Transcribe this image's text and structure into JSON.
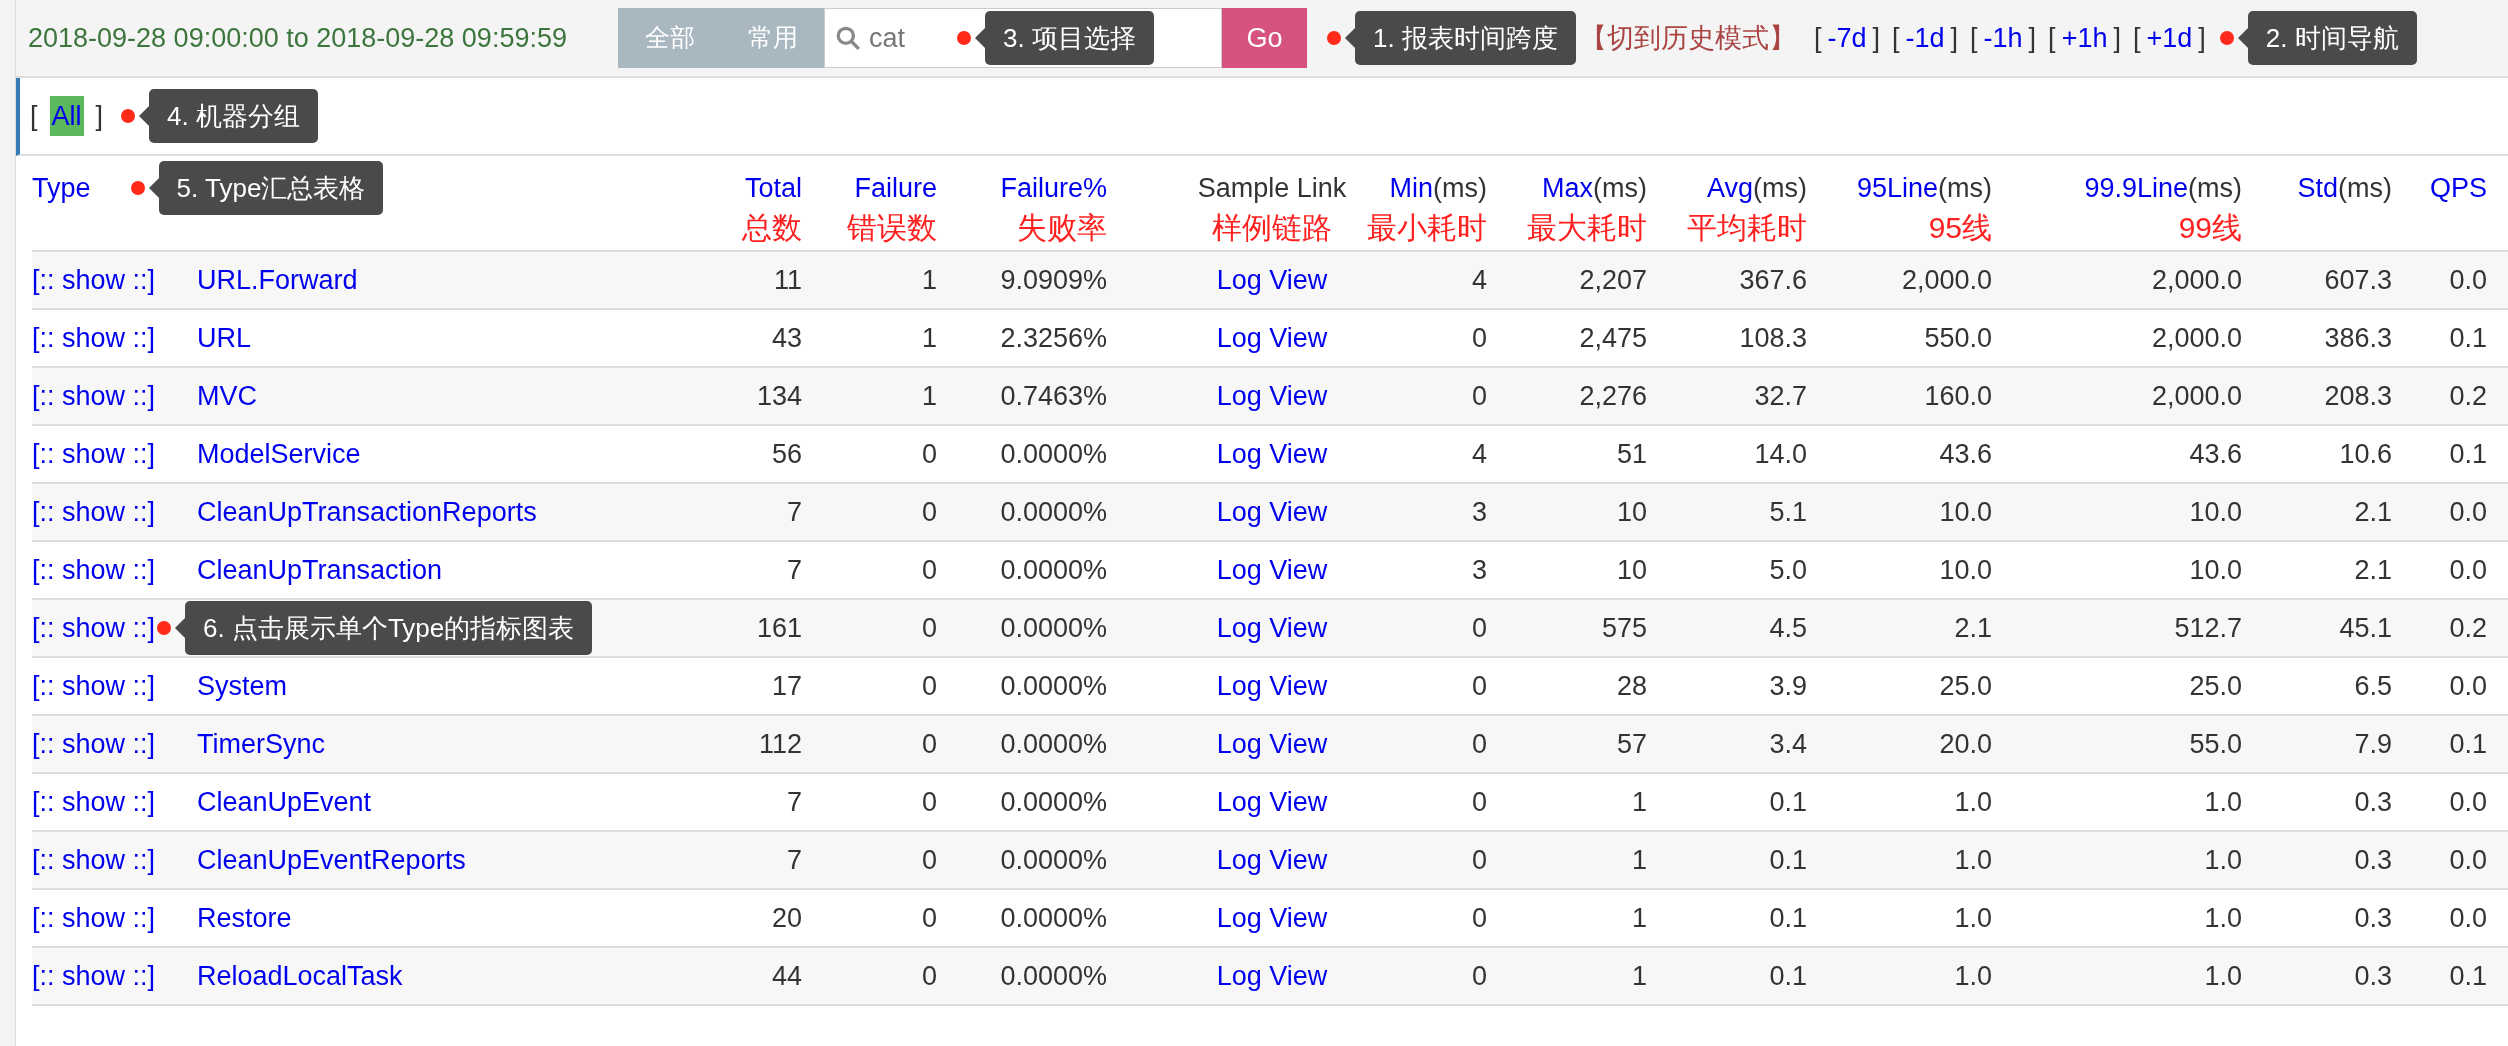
{
  "top_bar": {
    "time_range": "2018-09-28 09:00:00 to 2018-09-28 09:59:59",
    "scope_buttons": [
      {
        "label": "全部"
      },
      {
        "label": "常用"
      }
    ],
    "search": {
      "value": "cat"
    },
    "search_callout": "3. 项目选择",
    "go_button": "Go",
    "time_callout": "1. 报表时间跨度",
    "history_mode": "【切到历史模式】",
    "nav": [
      {
        "open": "[",
        "label": "-7d",
        "close": "]"
      },
      {
        "open": "[",
        "label": "-1d",
        "close": "]"
      },
      {
        "open": "[",
        "label": "-1h",
        "close": "]"
      },
      {
        "open": "[",
        "label": "+1h",
        "close": "]"
      },
      {
        "open": "[",
        "label": "+1d",
        "close": "]"
      }
    ],
    "nav_callout": "2. 时间导航"
  },
  "machine_group": {
    "open": "[",
    "label": "All",
    "close": "]",
    "selected": true,
    "callout": "4. 机器分组"
  },
  "table": {
    "columns": [
      {
        "label": "Type",
        "callout": "5. Type汇总表格",
        "kind": "sortable"
      },
      {
        "kind": "blank"
      },
      {
        "label": "Total",
        "note": "总数",
        "kind": "sortable"
      },
      {
        "label": "Failure",
        "note": "错误数",
        "kind": "sortable"
      },
      {
        "label": "Failure%",
        "note": "失败率",
        "kind": "sortable"
      },
      {
        "label": "Sample Link",
        "note": "样例链路",
        "kind": "plain"
      },
      {
        "label": "Min",
        "unit": "(ms)",
        "note": "最小耗时",
        "kind": "sortable"
      },
      {
        "label": "Max",
        "unit": "(ms)",
        "note": "最大耗时",
        "kind": "sortable"
      },
      {
        "label": "Avg",
        "unit": "(ms)",
        "note": "平均耗时",
        "kind": "sortable"
      },
      {
        "label": "95Line",
        "unit": "(ms)",
        "note": "95线",
        "kind": "sortable"
      },
      {
        "label": "99.9Line",
        "unit": "(ms)",
        "note": "99线",
        "kind": "sortable"
      },
      {
        "label": "Std",
        "unit": "(ms)",
        "kind": "sortable"
      },
      {
        "label": "QPS",
        "kind": "sortable"
      }
    ],
    "rows": [
      {
        "cells": [
          "[:: show ::]",
          "URL.Forward",
          "11",
          "1",
          "9.0909%",
          "Log View",
          "4",
          "2,207",
          "367.6",
          "2,000.0",
          "2,000.0",
          "607.3",
          "0.0"
        ]
      },
      {
        "cells": [
          "[:: show ::]",
          "URL",
          "43",
          "1",
          "2.3256%",
          "Log View",
          "0",
          "2,475",
          "108.3",
          "550.0",
          "2,000.0",
          "386.3",
          "0.1"
        ]
      },
      {
        "cells": [
          "[:: show ::]",
          "MVC",
          "134",
          "1",
          "0.7463%",
          "Log View",
          "0",
          "2,276",
          "32.7",
          "160.0",
          "2,000.0",
          "208.3",
          "0.2"
        ]
      },
      {
        "cells": [
          "[:: show ::]",
          "ModelService",
          "56",
          "0",
          "0.0000%",
          "Log View",
          "4",
          "51",
          "14.0",
          "43.6",
          "43.6",
          "10.6",
          "0.1"
        ]
      },
      {
        "cells": [
          "[:: show ::]",
          "CleanUpTransactionReports",
          "7",
          "0",
          "0.0000%",
          "Log View",
          "3",
          "10",
          "5.1",
          "10.0",
          "10.0",
          "2.1",
          "0.0"
        ]
      },
      {
        "cells": [
          "[:: show ::]",
          "CleanUpTransaction",
          "7",
          "0",
          "0.0000%",
          "Log View",
          "3",
          "10",
          "5.0",
          "10.0",
          "10.0",
          "2.1",
          "0.0"
        ]
      },
      {
        "cells": [
          "[:: show ::]",
          "",
          "161",
          "0",
          "0.0000%",
          "Log View",
          "0",
          "575",
          "4.5",
          "2.1",
          "512.7",
          "45.1",
          "0.2"
        ],
        "callout": "6. 点击展示单个Type的指标图表"
      },
      {
        "cells": [
          "[:: show ::]",
          "System",
          "17",
          "0",
          "0.0000%",
          "Log View",
          "0",
          "28",
          "3.9",
          "25.0",
          "25.0",
          "6.5",
          "0.0"
        ]
      },
      {
        "cells": [
          "[:: show ::]",
          "TimerSync",
          "112",
          "0",
          "0.0000%",
          "Log View",
          "0",
          "57",
          "3.4",
          "20.0",
          "55.0",
          "7.9",
          "0.1"
        ]
      },
      {
        "cells": [
          "[:: show ::]",
          "CleanUpEvent",
          "7",
          "0",
          "0.0000%",
          "Log View",
          "0",
          "1",
          "0.1",
          "1.0",
          "1.0",
          "0.3",
          "0.0"
        ]
      },
      {
        "cells": [
          "[:: show ::]",
          "CleanUpEventReports",
          "7",
          "0",
          "0.0000%",
          "Log View",
          "0",
          "1",
          "0.1",
          "1.0",
          "1.0",
          "0.3",
          "0.0"
        ]
      },
      {
        "cells": [
          "[:: show ::]",
          "Restore",
          "20",
          "0",
          "0.0000%",
          "Log View",
          "0",
          "1",
          "0.1",
          "1.0",
          "1.0",
          "0.3",
          "0.0"
        ]
      },
      {
        "cells": [
          "[:: show ::]",
          "ReloadLocalTask",
          "44",
          "0",
          "0.0000%",
          "Log View",
          "0",
          "1",
          "0.1",
          "1.0",
          "1.0",
          "0.3",
          "0.1"
        ]
      }
    ]
  }
}
